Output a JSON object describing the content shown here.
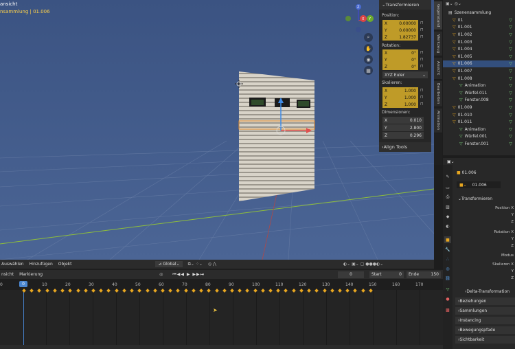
{
  "viewport": {
    "mode_label": "ansicht",
    "collection_label": "nsammlung | 01.006"
  },
  "npanel": {
    "header": "Transformieren",
    "position_label": "Position:",
    "position": [
      {
        "axis": "X",
        "value": "0.00000"
      },
      {
        "axis": "Y",
        "value": "0.00000"
      },
      {
        "axis": "Z",
        "value": "1.82737"
      }
    ],
    "rotation_label": "Rotation:",
    "rotation": [
      {
        "axis": "X",
        "value": "0°"
      },
      {
        "axis": "Y",
        "value": "0°"
      },
      {
        "axis": "Z",
        "value": "0°"
      }
    ],
    "euler": "XYZ Euler",
    "scale_label": "Skalieren:",
    "scale": [
      {
        "axis": "X",
        "value": "1.000"
      },
      {
        "axis": "Y",
        "value": "1.000"
      },
      {
        "axis": "Z",
        "value": "1.000"
      }
    ],
    "dim_label": "Dimensionen:",
    "dims": [
      {
        "axis": "X",
        "value": "0.010"
      },
      {
        "axis": "Y",
        "value": "2.800"
      },
      {
        "axis": "Z",
        "value": "0.296"
      }
    ],
    "align": "Align Tools"
  },
  "vtabs": [
    "Gegenstand",
    "Werkzeug",
    "Ansicht",
    "Bearbeiten",
    "Animation"
  ],
  "outliner": {
    "title": "Szenensammlung",
    "rows": [
      {
        "name": "01",
        "indent": 0
      },
      {
        "name": "01.001",
        "indent": 0
      },
      {
        "name": "01.002",
        "indent": 0
      },
      {
        "name": "01.003",
        "indent": 0
      },
      {
        "name": "01.004",
        "indent": 0
      },
      {
        "name": "01.005",
        "indent": 0
      },
      {
        "name": "01.006",
        "indent": 0,
        "sel": true
      },
      {
        "name": "01.007",
        "indent": 0
      },
      {
        "name": "01.008",
        "indent": 0
      },
      {
        "name": "Animation",
        "indent": 1
      },
      {
        "name": "Würfel.011",
        "indent": 1
      },
      {
        "name": "Fenster.008",
        "indent": 1
      },
      {
        "name": "01.009",
        "indent": 0
      },
      {
        "name": "01.010",
        "indent": 0
      },
      {
        "name": "01.011",
        "indent": 0
      },
      {
        "name": "Animation",
        "indent": 1
      },
      {
        "name": "Würfel.001",
        "indent": 1
      },
      {
        "name": "Fenster.001",
        "indent": 1
      }
    ]
  },
  "props": {
    "object_name": "01.006",
    "data_name": "01.006",
    "sections": [
      "Transformieren",
      "Delta-Transformation",
      "Beziehungen",
      "Sammlungen",
      "Instancing",
      "Bewegungspfade",
      "Sichtbarkeit"
    ],
    "labels": [
      "Position X",
      "Y",
      "Z",
      "Rotation X",
      "Y",
      "Z",
      "Modus",
      "Skalieren X",
      "Y",
      "Z"
    ]
  },
  "vheader": {
    "items": [
      "Auswählen",
      "Hinzufügen",
      "Objekt"
    ],
    "orientation": "Global"
  },
  "timeline": {
    "menu": [
      "nsicht",
      "Markierung"
    ],
    "current_frame": "0",
    "start_label": "Start",
    "start": "0",
    "end_label": "Ende",
    "end": "150",
    "ticks": [
      "0",
      "10",
      "20",
      "30",
      "40",
      "50",
      "60",
      "70",
      "80",
      "90",
      "100",
      "110",
      "120",
      "130",
      "140",
      "150",
      "160",
      "170"
    ],
    "playhead": "0"
  }
}
